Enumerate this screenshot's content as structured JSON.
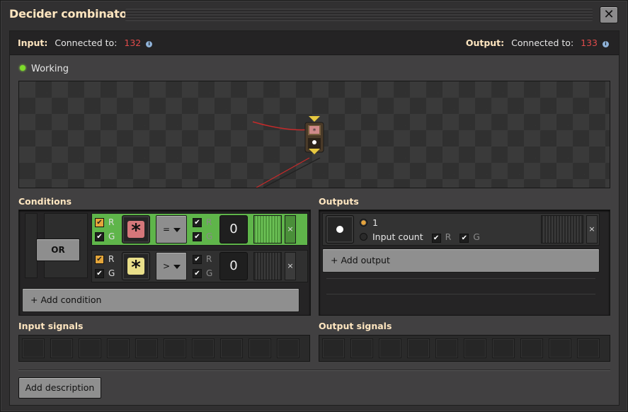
{
  "window": {
    "title": "Decider combinator",
    "close_label": "✕"
  },
  "connections": {
    "input_label": "Input:",
    "input_connected_to": "Connected to:",
    "input_id": "132",
    "output_label": "Output:",
    "output_connected_to": "Connected to:",
    "output_id": "133",
    "info_glyph": "i"
  },
  "status": {
    "text": "Working",
    "color": "#7ddc2a"
  },
  "conditions": {
    "title": "Conditions",
    "or_label": "OR",
    "rows": [
      {
        "wire_r": "R",
        "wire_g": "G",
        "r_checked": true,
        "g_checked": true,
        "signal_icon": "asterisk-red-icon",
        "signal_glyph": "*",
        "operator": "=",
        "right_r": "R",
        "right_g": "G",
        "constant": "0",
        "remove": "×"
      },
      {
        "wire_r": "R",
        "wire_g": "G",
        "r_checked": true,
        "g_checked": true,
        "signal_icon": "asterisk-yellow-icon",
        "signal_glyph": "*",
        "operator": ">",
        "right_r": "R",
        "right_g": "G",
        "constant": "0",
        "remove": "×"
      }
    ],
    "add_label": "+ Add condition"
  },
  "outputs": {
    "title": "Outputs",
    "row": {
      "signal_icon": "dot-signal-icon",
      "opt_constant": "1",
      "opt_input": "Input count",
      "r_label": "R",
      "g_label": "G",
      "remove": "×"
    },
    "add_label": "+ Add output"
  },
  "input_signals": {
    "title": "Input signals"
  },
  "output_signals": {
    "title": "Output signals"
  },
  "footer": {
    "add_description": "Add description"
  },
  "colors": {
    "accent_title": "#ffe6c0",
    "connected_red": "#e14b4b",
    "condition_active": "#5fb54a"
  }
}
